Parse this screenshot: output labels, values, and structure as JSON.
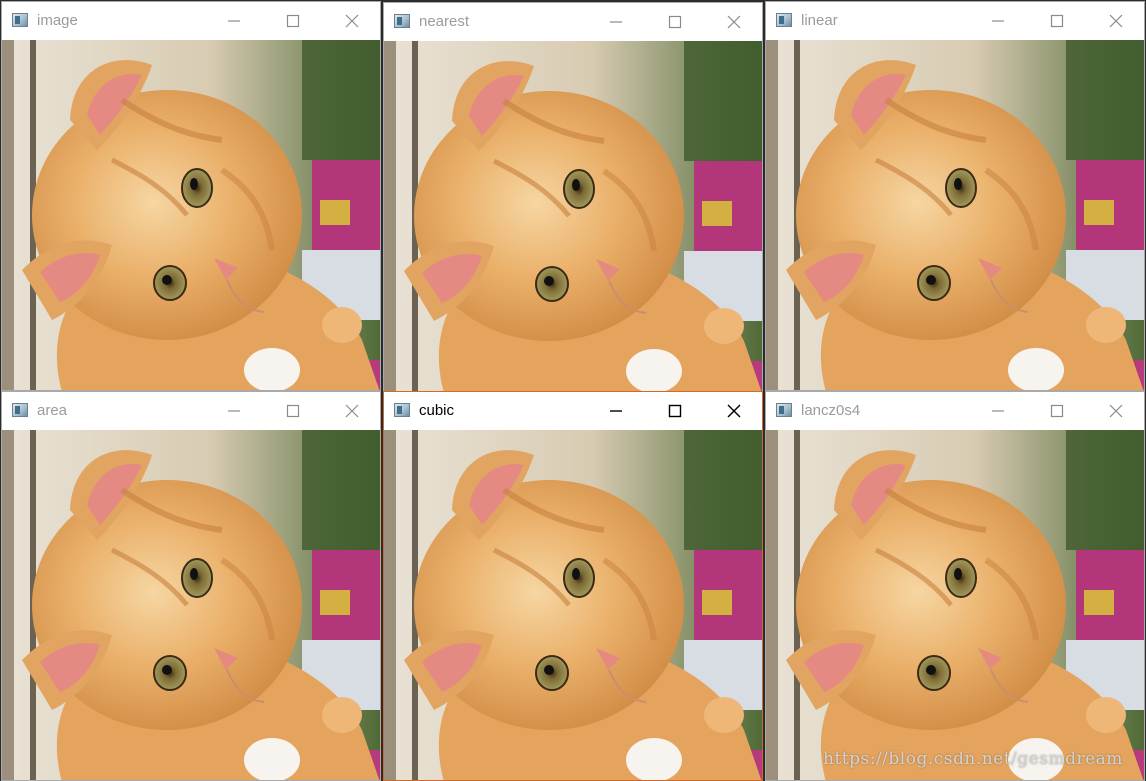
{
  "windows": [
    {
      "title": "image",
      "active": false,
      "image_icon": "kitten-photo"
    },
    {
      "title": "nearest",
      "active": false,
      "image_icon": "kitten-photo"
    },
    {
      "title": "linear",
      "active": false,
      "image_icon": "kitten-photo"
    },
    {
      "title": "area",
      "active": false,
      "image_icon": "kitten-photo"
    },
    {
      "title": "cubic",
      "active": true,
      "image_icon": "kitten-photo"
    },
    {
      "title": "lancz0s4",
      "active": false,
      "image_icon": "kitten-photo"
    }
  ],
  "window_controls": {
    "minimize_icon": "minimize-icon",
    "maximize_icon": "maximize-icon",
    "close_icon": "close-icon"
  },
  "watermark": "https://blog.csdn.net/gesmdream",
  "colors": {
    "active_border": "#d06a2a",
    "inactive_title": "#9b9b9b",
    "fur": "#e8a85c"
  }
}
